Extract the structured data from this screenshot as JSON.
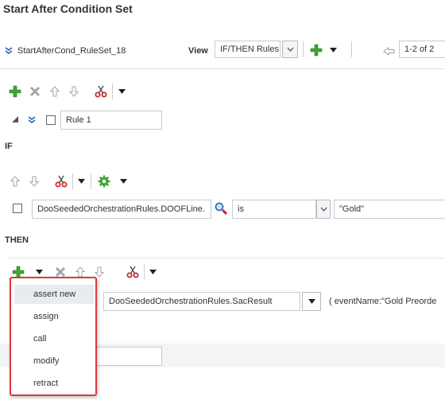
{
  "page": {
    "title": "Start After Condition Set"
  },
  "ruleset": {
    "name": "StartAfterCond_RuleSet_18",
    "view_label": "View",
    "view_value": "IF/THEN Rules",
    "pager": "1-2 of 2"
  },
  "rule": {
    "name": "Rule 1"
  },
  "if_section": {
    "label": "IF",
    "condition": {
      "field": "DooSeededOrchestrationRules.DOOFLine.",
      "operator": "is",
      "value": "\"Gold\""
    }
  },
  "then_section": {
    "label": "THEN",
    "action": {
      "fact": "DooSeededOrchestrationRules.SacResult",
      "args": "( eventName:\"Gold Preorde"
    }
  },
  "action_menu": {
    "items": [
      {
        "label": "assert new",
        "highlighted": true
      },
      {
        "label": "assign"
      },
      {
        "label": "call"
      },
      {
        "label": "modify"
      },
      {
        "label": "retract"
      }
    ]
  },
  "colors": {
    "add_green": "#3fa535",
    "delete_grey": "#a0a6ac",
    "cut_red": "#d0262b",
    "menu_border": "#e0383a",
    "link_blue": "#1d62b6"
  }
}
